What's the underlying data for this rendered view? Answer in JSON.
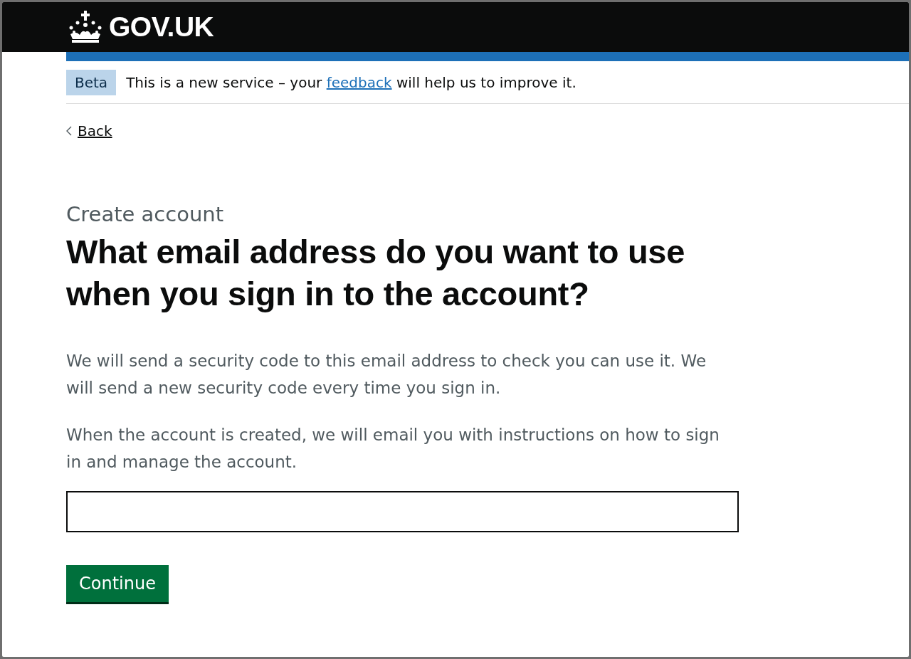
{
  "header": {
    "logo_text": "GOV.UK"
  },
  "phase_banner": {
    "tag": "Beta",
    "text_before": "This is a new service – your ",
    "link": "feedback",
    "text_after": " will help us to improve it."
  },
  "back_link": "Back",
  "caption": "Create account",
  "heading": "What email address do you want to use when you sign in to the account?",
  "paragraphs": [
    "We will send a security code to this email address to check you can use it. We will send a new security code every time you sign in.",
    "When the account is created, we will email you with instructions on how to sign in and manage the account."
  ],
  "button": "Continue"
}
